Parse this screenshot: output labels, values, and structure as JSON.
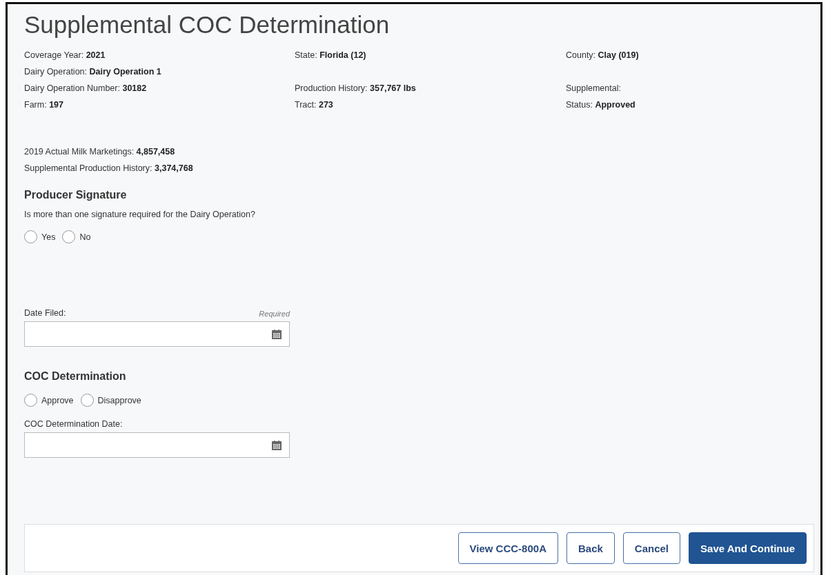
{
  "title": "Supplemental COC Determination",
  "detail_rows": [
    [
      {
        "label": "Coverage Year:",
        "value": "2021"
      },
      {
        "label": "State:",
        "value": "Florida (12)"
      },
      {
        "label": "County:",
        "value": "Clay (019)"
      }
    ],
    [
      {
        "label": "Dairy Operation:",
        "value": "Dairy Operation 1"
      }
    ],
    [
      {
        "label": "Dairy Operation Number:",
        "value": "30182"
      },
      {
        "label": "Production History:",
        "value": "357,767 lbs"
      },
      {
        "label": "Supplemental:"
      }
    ],
    [
      {
        "label": "Farm:",
        "value": "197"
      },
      {
        "label": "Tract:",
        "value": "273"
      },
      {
        "label": "Status:",
        "value": "Approved"
      }
    ]
  ],
  "history": [
    {
      "label": "2019 Actual Milk Marketings:",
      "value": "4,857,458"
    },
    {
      "label": "Supplemental Production History:",
      "value": "3,374,768"
    }
  ],
  "producer_signature": {
    "heading": "Producer Signature",
    "question": "Is more than one signature required for the Dairy Operation?",
    "options": [
      {
        "label": "Yes",
        "selected": false
      },
      {
        "label": "No",
        "selected": false
      }
    ]
  },
  "date_filed": {
    "label": "Date Filed:",
    "required": "Required"
  },
  "coc_determination": {
    "heading": "COC Determination",
    "options": [
      {
        "label": "Approve",
        "selected": false
      },
      {
        "label": "Disapprove",
        "selected": false
      }
    ]
  },
  "coc_date": {
    "label": "COC Determination Date:"
  },
  "buttons": [
    {
      "label": "View CCC-800A",
      "kind": "secondary"
    },
    {
      "label": "Back",
      "kind": "secondary"
    },
    {
      "label": "Cancel",
      "kind": "secondary"
    },
    {
      "label": "Save And Continue",
      "kind": "primary"
    }
  ]
}
